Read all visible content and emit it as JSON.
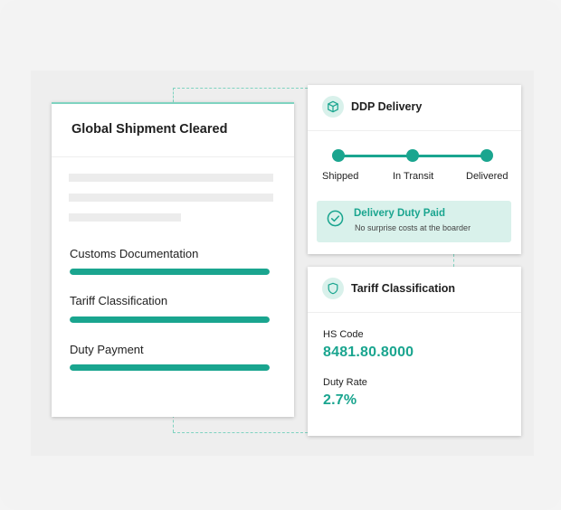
{
  "left_card": {
    "title": "Global Shipment Cleared",
    "progress_items": [
      {
        "label": "Customs Documentation",
        "progress": 1.0
      },
      {
        "label": "Tariff Classification",
        "progress": 1.0
      },
      {
        "label": "Duty Payment",
        "progress": 1.0
      }
    ]
  },
  "ddp_card": {
    "title": "DDP Delivery",
    "icon": "package-icon",
    "steps": [
      "Shipped",
      "In Transit",
      "Delivered"
    ],
    "notice": {
      "title": "Delivery Duty Paid",
      "subtitle": "No surprise costs at the boarder",
      "icon": "check-circle-icon"
    }
  },
  "tariff_card": {
    "title": "Tariff Classification",
    "icon": "shield-icon",
    "hs_code_label": "HS Code",
    "hs_code_value": "8481.80.8000",
    "duty_rate_label": "Duty Rate",
    "duty_rate_value": "2.7%"
  },
  "colors": {
    "accent": "#1aa58f",
    "accent_light": "#d9f1eb",
    "dashed_connector": "#7fd3c0"
  }
}
